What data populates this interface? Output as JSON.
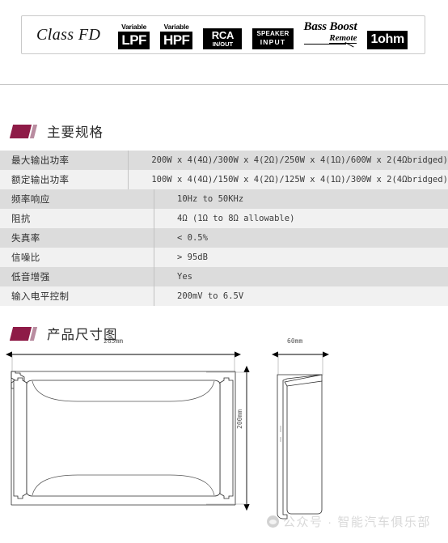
{
  "badge_bar": {
    "brand": "Class FD",
    "badges": [
      {
        "type": "stacked",
        "over": "Variable",
        "main": "LPF",
        "name": "variable-lpf-badge"
      },
      {
        "type": "stacked",
        "over": "Variable",
        "main": "HPF",
        "name": "variable-hpf-badge"
      },
      {
        "type": "two-line",
        "line1": "RCA",
        "line2": "IN/OUT",
        "name": "rca-in-out-badge"
      },
      {
        "type": "speaker",
        "line1": "SPEAKER",
        "line2": "INPUT",
        "name": "speaker-input-badge"
      },
      {
        "type": "bassboost",
        "line1": "Bass Boost",
        "line2": "Remote",
        "name": "bass-boost-remote-badge"
      },
      {
        "type": "ohm",
        "main": "1ohm",
        "name": "one-ohm-badge"
      }
    ]
  },
  "sections": {
    "specs_title": "主要规格",
    "dimensions_title": "产品尺寸图"
  },
  "spec_table": {
    "rows": [
      {
        "label": "最大输出功率",
        "value": "200W x 4(4Ω)/300W x 4(2Ω)/250W x 4(1Ω)/600W x 2(4Ωbridged)"
      },
      {
        "label": "额定输出功率",
        "value": "100W x 4(4Ω)/150W x 4(2Ω)/125W x 4(1Ω)/300W x 2(4Ωbridged)"
      },
      {
        "label": "频率响应",
        "value": "10Hz to 50KHz"
      },
      {
        "label": "阻抗",
        "value": "4Ω (1Ω to 8Ω allowable)"
      },
      {
        "label": "失真率",
        "value": "< 0.5%"
      },
      {
        "label": "信噪比",
        "value": "> 95dB"
      },
      {
        "label": "低音增强",
        "value": "Yes"
      },
      {
        "label": "输入电平控制",
        "value": "200mV to 6.5V"
      }
    ]
  },
  "dimensions": {
    "top_width_label": "265mm",
    "top_height_label": "200mm",
    "side_width_label": "60mm"
  },
  "watermark": {
    "text": "公众号 · 智能汽车俱乐部"
  },
  "colors": {
    "accent": "#8e1b47",
    "accent_light": "#b98ca0",
    "row_shade": "#dcdcdc",
    "row_plain": "#f1f1f1",
    "rule": "#c6c6c6"
  }
}
